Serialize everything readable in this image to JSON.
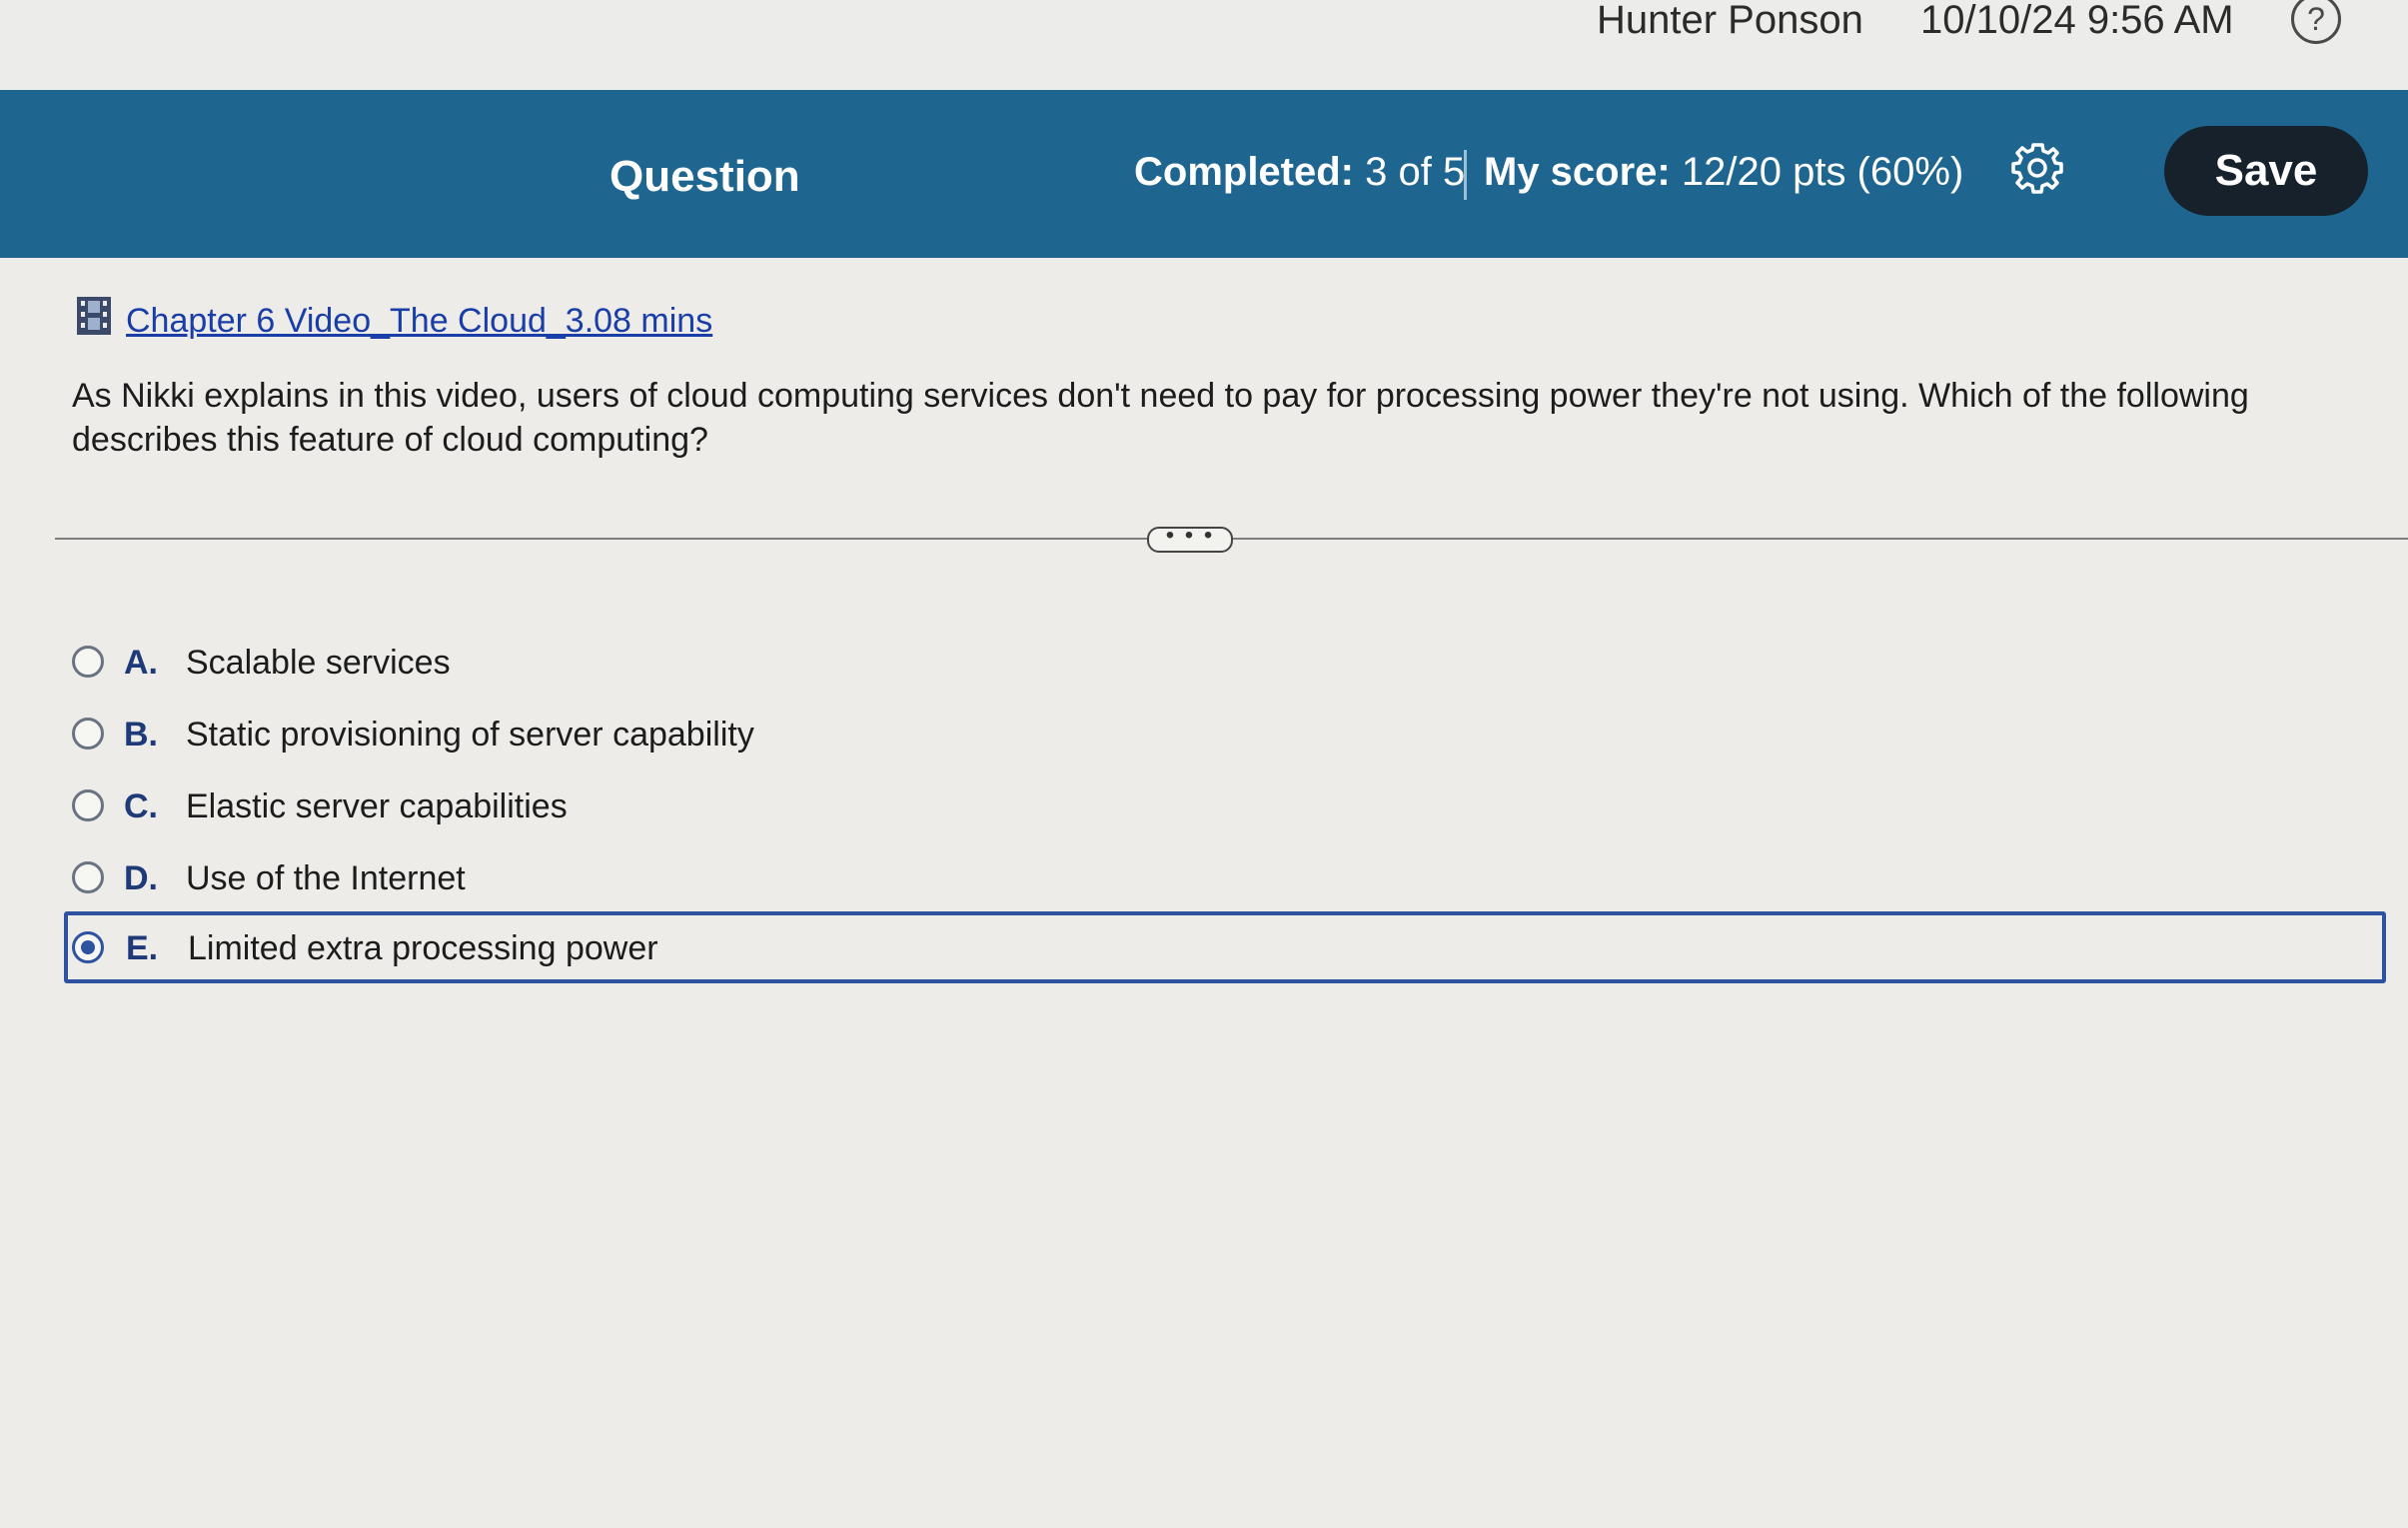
{
  "topbar": {
    "user_name": "Hunter Ponson",
    "datetime": "10/10/24 9:56 AM",
    "help_symbol": "?"
  },
  "header": {
    "title": "Question",
    "completed_label": "Completed:",
    "completed_value": "3 of 5",
    "score_label": "My score:",
    "score_value": "12/20 pts (60%)",
    "settings_icon": "gear-icon",
    "save_label": "Save",
    "band_color": "#1e6690"
  },
  "question": {
    "video_icon": "film-icon",
    "video_link": "Chapter 6 Video_The Cloud_3.08 mins",
    "text": "As Nikki explains in this video, users of cloud computing services don't need to pay for processing power they're not using. Which of the following describes this feature of cloud computing?",
    "expand_symbol": "• • •"
  },
  "options": [
    {
      "letter": "A.",
      "text": "Scalable services",
      "selected": false
    },
    {
      "letter": "B.",
      "text": "Static provisioning of server capability",
      "selected": false
    },
    {
      "letter": "C.",
      "text": "Elastic server capabilities",
      "selected": false
    },
    {
      "letter": "D.",
      "text": "Use of the Internet",
      "selected": false
    },
    {
      "letter": "E.",
      "text": "Limited extra processing power",
      "selected": true
    }
  ],
  "colors": {
    "accent": "#2c52a0",
    "link": "#1a3ea8",
    "save_button": "#16212b"
  }
}
